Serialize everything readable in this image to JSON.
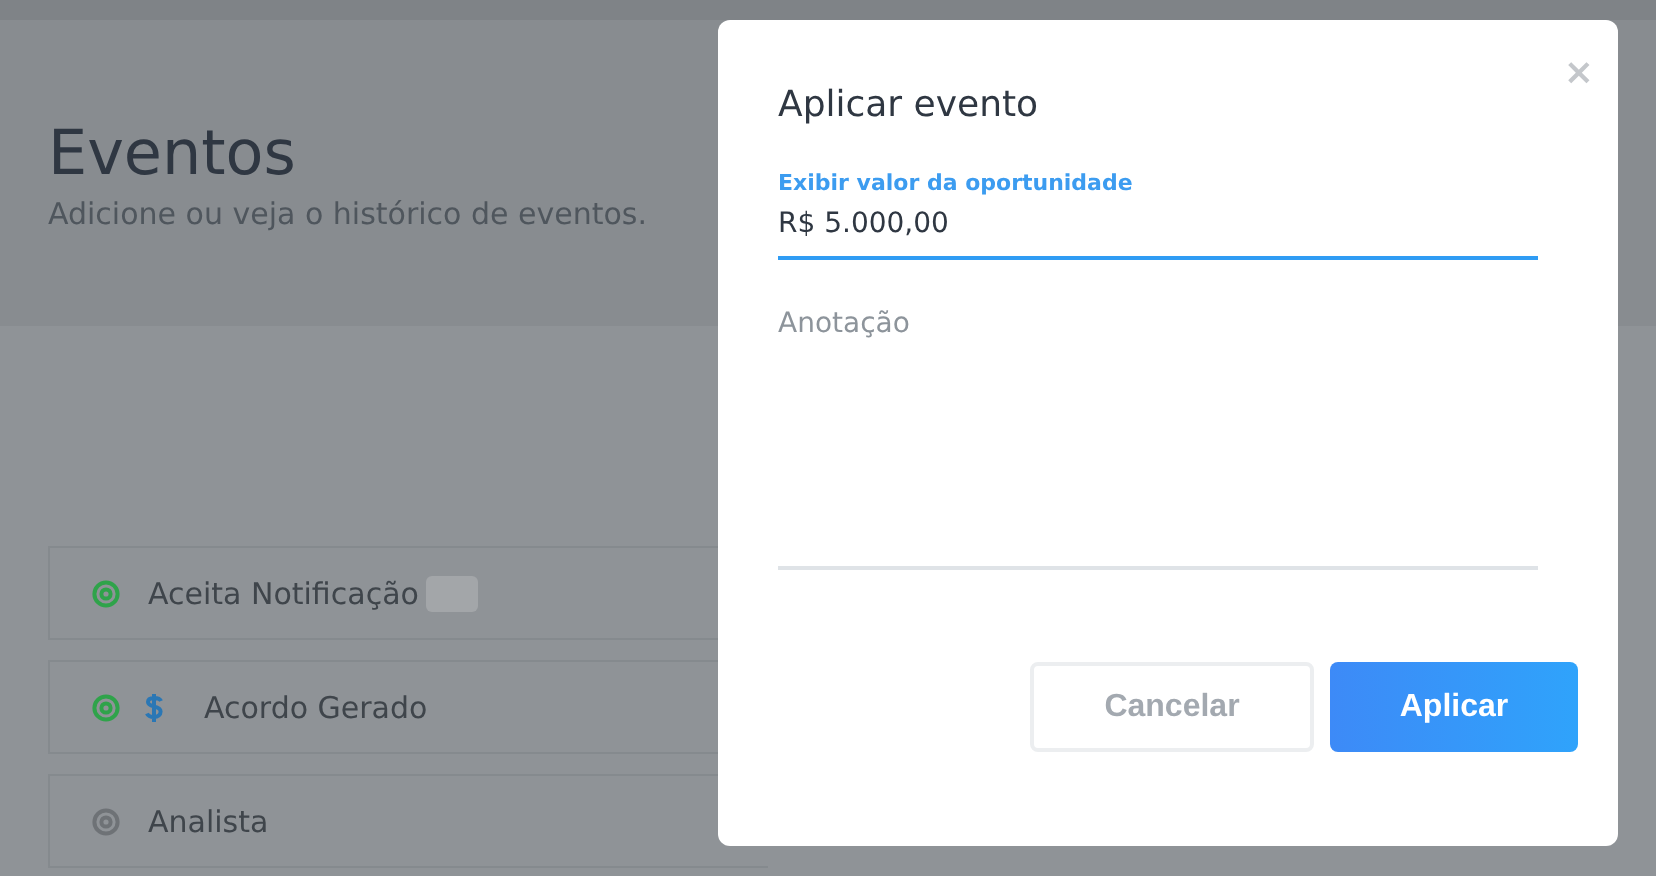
{
  "page": {
    "title": "Eventos",
    "subtitle": "Adicione ou veja o histórico de eventos."
  },
  "events": [
    {
      "name": "Aceita Notificação",
      "color": "#2fa34a",
      "has_value": false,
      "has_badge": true
    },
    {
      "name": "Acordo Gerado",
      "color": "#2fa34a",
      "has_value": true,
      "has_badge": false
    },
    {
      "name": "Analista",
      "color": "#6e7276",
      "has_value": false,
      "has_badge": false
    }
  ],
  "dialog": {
    "title": "Aplicar evento",
    "close": "×",
    "value_field": {
      "label": "Exibir valor da oportunidade",
      "value": "R$ 5.000,00",
      "focused": true
    },
    "note_field": {
      "placeholder": "Anotação"
    },
    "buttons": [
      {
        "label": "Cancelar",
        "kind": "secondary"
      },
      {
        "label": "Aplicar",
        "kind": "primary"
      }
    ]
  }
}
